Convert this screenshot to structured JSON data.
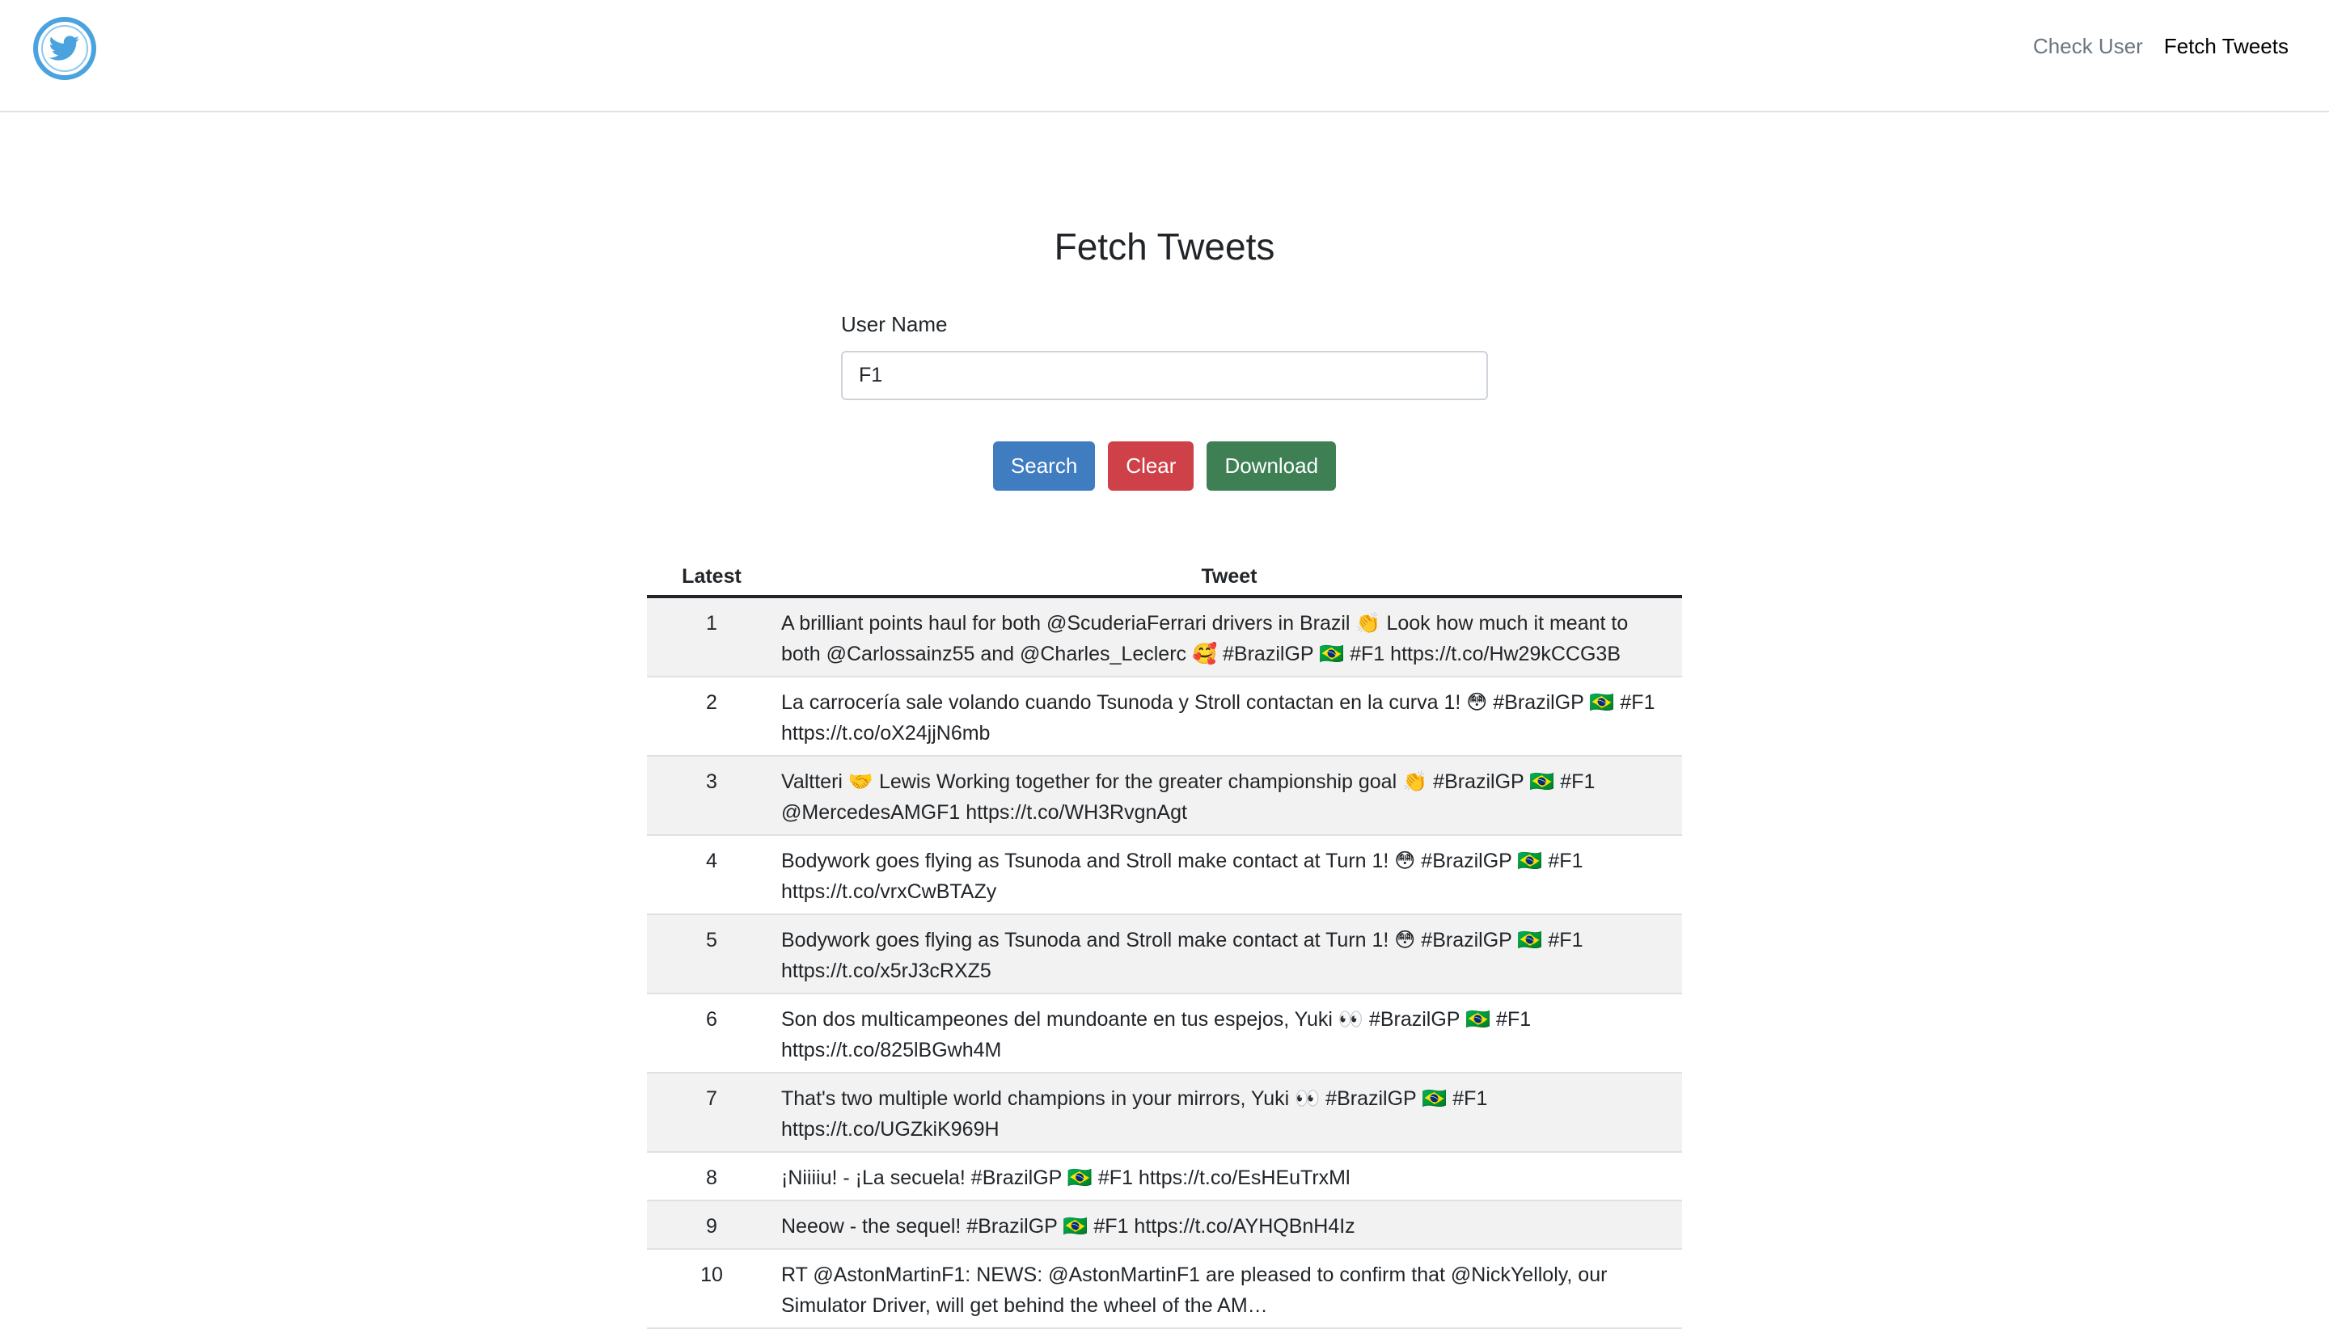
{
  "nav": {
    "logo_icon": "twitter-bird-icon",
    "brand_color": "#4aa3df",
    "links": [
      {
        "label": "Check User",
        "active": false
      },
      {
        "label": "Fetch Tweets",
        "active": true
      }
    ]
  },
  "page": {
    "title": "Fetch Tweets",
    "username_label": "User Name",
    "username_value": "F1"
  },
  "buttons": {
    "search": "Search",
    "clear": "Clear",
    "download": "Download"
  },
  "table": {
    "headers": {
      "latest": "Latest",
      "tweet": "Tweet"
    },
    "rows": [
      {
        "n": "1",
        "text": "A brilliant points haul for both @ScuderiaFerrari drivers in Brazil 👏 Look how much it meant to both @Carlossainz55 and @Charles_Leclerc 🥰 #BrazilGP 🇧🇷 #F1 https://t.co/Hw29kCCG3B"
      },
      {
        "n": "2",
        "text": "La carrocería sale volando cuando Tsunoda y Stroll contactan en la curva 1! 😳 #BrazilGP 🇧🇷 #F1 https://t.co/oX24jjN6mb"
      },
      {
        "n": "3",
        "text": "Valtteri 🤝 Lewis Working together for the greater championship goal 👏 #BrazilGP 🇧🇷 #F1 @MercedesAMGF1 https://t.co/WH3RvgnAgt"
      },
      {
        "n": "4",
        "text": "Bodywork goes flying as Tsunoda and Stroll make contact at Turn 1! 😳 #BrazilGP 🇧🇷 #F1 https://t.co/vrxCwBTAZy"
      },
      {
        "n": "5",
        "text": "Bodywork goes flying as Tsunoda and Stroll make contact at Turn 1! 😳 #BrazilGP 🇧🇷 #F1 https://t.co/x5rJ3cRXZ5"
      },
      {
        "n": "6",
        "text": "Son dos multicampeones del mundoante en tus espejos, Yuki 👀 #BrazilGP 🇧🇷 #F1 https://t.co/825lBGwh4M"
      },
      {
        "n": "7",
        "text": "That's two multiple world champions in your mirrors, Yuki 👀 #BrazilGP 🇧🇷 #F1 https://t.co/UGZkiK969H"
      },
      {
        "n": "8",
        "text": "¡Niiiiu! - ¡La secuela! #BrazilGP 🇧🇷 #F1 https://t.co/EsHEuTrxMl"
      },
      {
        "n": "9",
        "text": "Neeow - the sequel! #BrazilGP 🇧🇷 #F1 https://t.co/AYHQBnH4Iz"
      },
      {
        "n": "10",
        "text": "RT @AstonMartinF1: NEWS: @AstonMartinF1 are pleased to confirm that @NickYelloly, our Simulator Driver, will get behind the wheel of the AM…"
      }
    ]
  }
}
